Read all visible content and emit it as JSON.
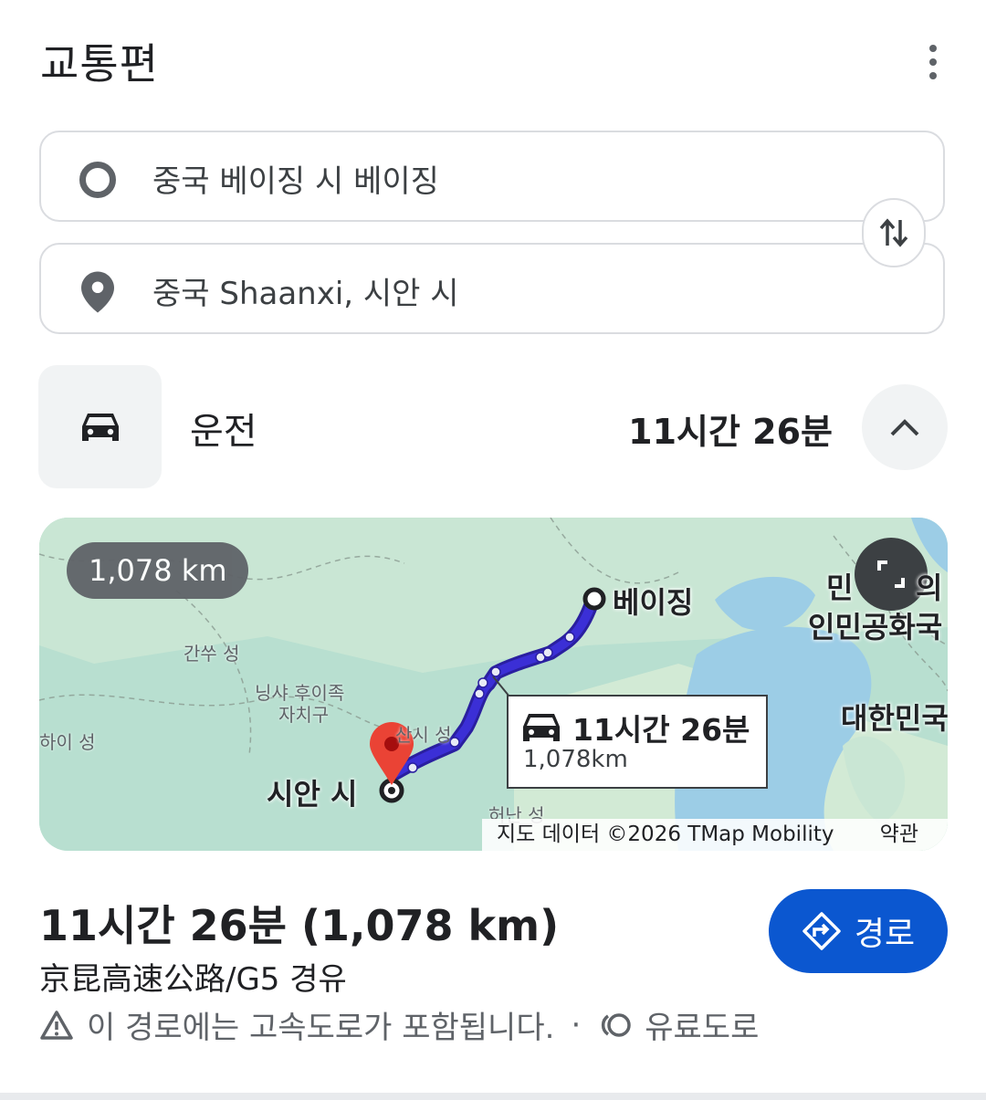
{
  "header": {
    "title": "교통편",
    "more_icon": "more-vert-icon"
  },
  "origin": {
    "value": "중국 베이징 시 베이징",
    "icon": "origin-circle-icon"
  },
  "destination": {
    "value": "중국 Shaanxi, 시안 시",
    "icon": "location-pin-icon"
  },
  "swap": {
    "icon": "swap-vert-icon"
  },
  "mode": {
    "icon": "car-icon",
    "label": "운전",
    "duration": "11시간 26분",
    "toggle_icon": "chevron-up-icon"
  },
  "map": {
    "distance_pill": "1,078 km",
    "expand_icon": "fullscreen-icon",
    "route_card": {
      "duration": "11시간 26분",
      "distance": "1,078km"
    },
    "labels": {
      "beijing": "베이징",
      "xian": "시안 시",
      "korea_dprk_1": "민",
      "korea_dprk_1b": "의",
      "korea_dprk_2": "인민공화국",
      "korea_south": "대한민국",
      "gansu": "간쑤 성",
      "ningxia_1": "닝샤 후이족",
      "ningxia_2": "자치구",
      "qinghai": "하이 성",
      "shanxi": "산시 성",
      "henan": "허난 성"
    },
    "attribution": "지도 데이터 ©2026 TMap Mobility",
    "terms": "약관",
    "colors": {
      "route": "#3b2fd6",
      "water": "#9ccde6",
      "land": "#b8dfd0",
      "pin": "#ea4335"
    }
  },
  "summary": {
    "time_distance": "11시간 26분 (1,078 km)",
    "via": "京昆高速公路/G5 경유",
    "warning": "이 경로에는 고속도로가 포함됩니다.",
    "separator": "·",
    "toll": "유료도로",
    "go_button": "경로"
  },
  "accent": "#0b57d0"
}
